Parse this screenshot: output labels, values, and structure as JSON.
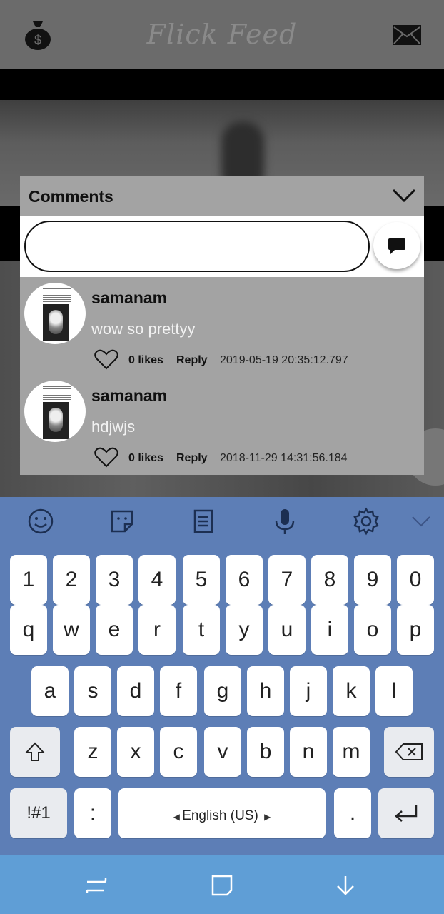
{
  "app": {
    "title": "Flick Feed"
  },
  "comments_panel": {
    "title": "Comments",
    "input_value": "",
    "items": [
      {
        "username": "samanam",
        "text": "wow so prettyy",
        "likes": "0 likes",
        "reply": "Reply",
        "timestamp": "2019-05-19 20:35:12.797"
      },
      {
        "username": "samanam",
        "text": "hdjwjs",
        "likes": "0 likes",
        "reply": "Reply",
        "timestamp": "2018-11-29 14:31:56.184"
      }
    ]
  },
  "keyboard": {
    "number_row": [
      "1",
      "2",
      "3",
      "4",
      "5",
      "6",
      "7",
      "8",
      "9",
      "0"
    ],
    "row1": [
      "q",
      "w",
      "e",
      "r",
      "t",
      "y",
      "u",
      "i",
      "o",
      "p"
    ],
    "row2": [
      "a",
      "s",
      "d",
      "f",
      "g",
      "h",
      "j",
      "k",
      "l"
    ],
    "row3": [
      "z",
      "x",
      "c",
      "v",
      "b",
      "n",
      "m"
    ],
    "symbols_label": "!#1",
    "colon_label": ":",
    "space_label": "English (US)",
    "period_label": "."
  },
  "colors": {
    "keyboard_bg": "#5d7eb6",
    "navbar_bg": "#5f9ed6",
    "panel_bg": "#a3a3a3"
  },
  "icons": {
    "header_left": "money-bag-icon",
    "header_right": "mail-icon",
    "collapse": "chevron-down-icon",
    "send": "chat-bubble-icon",
    "like": "heart-icon",
    "keyboard_tools": [
      "emoji-icon",
      "sticker-icon",
      "clipboard-icon",
      "microphone-icon",
      "settings-icon",
      "chevron-down-icon"
    ],
    "navbar": [
      "recent-apps-icon",
      "home-icon",
      "back-icon"
    ]
  }
}
